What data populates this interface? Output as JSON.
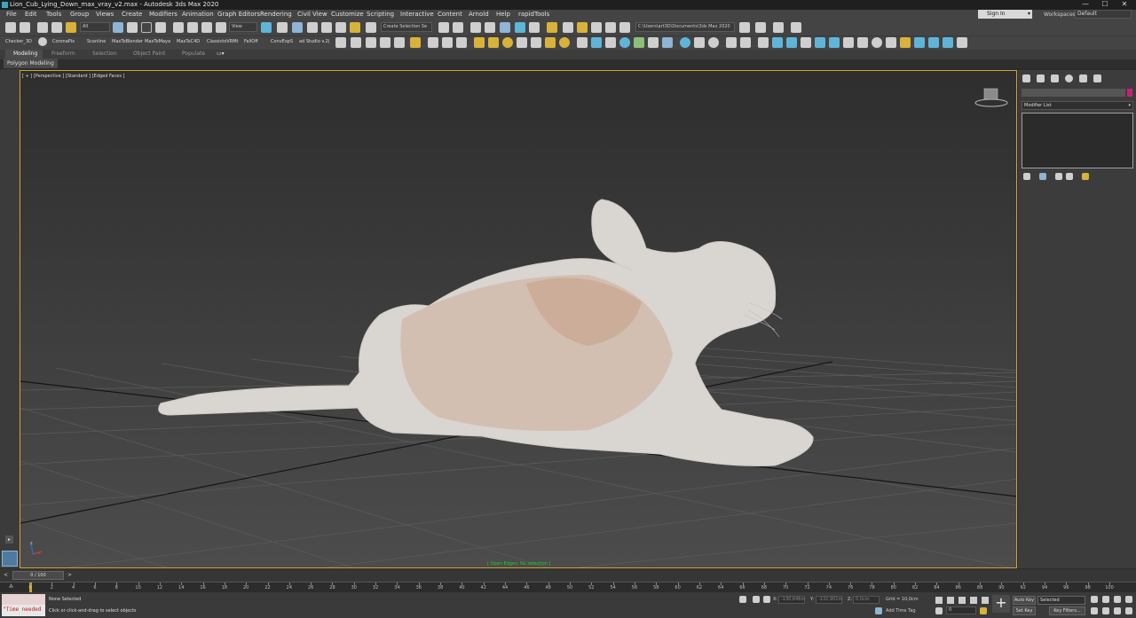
{
  "window": {
    "title": "Lion_Cub_Lying_Down_max_vray_v2.max - Autodesk 3ds Max 2020",
    "min": "—",
    "max": "☐",
    "close": "✕"
  },
  "menu": {
    "items": [
      "File",
      "Edit",
      "Tools",
      "Group",
      "Views",
      "Create",
      "Modifiers",
      "Animation",
      "Graph Editors",
      "Rendering",
      "Civil View",
      "Customize",
      "Scripting",
      "Interactive",
      "Content",
      "Arnold",
      "Help",
      "rapidTools"
    ],
    "sign_in": "Sign In",
    "workspaces_label": "Workspaces:",
    "workspace_value": "Default"
  },
  "toolbar": {
    "selection_filter": "All",
    "ref_coord": "View",
    "named_selection": "Create Selection Se",
    "project_path": "C:\\Users\\art3D\\Documents\\3ds Max 2020"
  },
  "scripts": {
    "items": [
      "Checker_3D",
      "CoronaPix",
      "Scanline",
      "MaxToBlender",
      "MaxToMaya",
      "MaxToC4D",
      "ClassictoVRMt",
      "FallOff",
      "ConvExpS",
      "ad Studio v.2("
    ]
  },
  "ribbon": {
    "tabs": [
      "Modeling",
      "Freeform",
      "Selection",
      "Object Paint",
      "Populate"
    ],
    "active_tab": "Modeling",
    "sub_label": "Polygon Modeling"
  },
  "viewport": {
    "label": "[ + ] [Perspective ] [Standard ] [Edged Faces ]",
    "status": "[ Open Edges: No selection ]",
    "axis_x": "x",
    "axis_y": "y",
    "axis_z": "z"
  },
  "command_panel": {
    "modifier_list": "Modifier List"
  },
  "timeline": {
    "frame_display": "0 / 100",
    "ticks": [
      "0",
      "2",
      "4",
      "6",
      "8",
      "10",
      "12",
      "14",
      "16",
      "18",
      "20",
      "22",
      "24",
      "26",
      "28",
      "30",
      "32",
      "34",
      "36",
      "38",
      "40",
      "42",
      "44",
      "46",
      "48",
      "50",
      "52",
      "54",
      "56",
      "58",
      "60",
      "62",
      "64",
      "66",
      "68",
      "70",
      "72",
      "74",
      "76",
      "78",
      "80",
      "82",
      "84",
      "86",
      "88",
      "90",
      "92",
      "94",
      "96",
      "98",
      "100"
    ],
    "current_frame": 0
  },
  "status": {
    "maxscript_text": "\"Time needed",
    "selection": "None Selected",
    "prompt": "Click or click-and-drag to select objects",
    "x_label": "X:",
    "x_value": "-130,646m",
    "y_label": "Y:",
    "y_value": "-132,901m",
    "z_label": "Z:",
    "z_value": "0,0cm",
    "grid": "Grid = 10,0cm",
    "add_time_tag": "Add Time Tag",
    "auto_key": "Auto Key",
    "set_key": "Set Key",
    "selected": "Selected",
    "key_filters": "Key Filters...",
    "frame_value": "0"
  },
  "colors": {
    "viewport_border": "#d1a435",
    "status_green": "#27c827",
    "maxscript_red": "#b21f1f"
  }
}
